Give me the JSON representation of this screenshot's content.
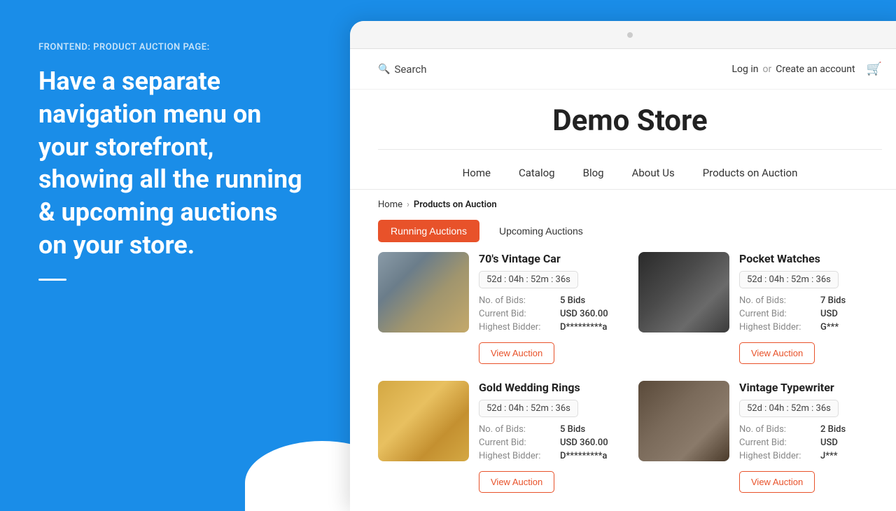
{
  "left": {
    "label": "FRONTEND: PRODUCT AUCTION PAGE:",
    "heading": "Have a separate navigation menu on your storefront, showing all the running & upcoming auctions on your store."
  },
  "browser": {
    "dot": ""
  },
  "header": {
    "search_label": "Search",
    "login_label": "Log in",
    "or_label": "or",
    "create_account_label": "Create an account"
  },
  "store": {
    "title": "Demo Store"
  },
  "nav": {
    "items": [
      {
        "label": "Home",
        "id": "home"
      },
      {
        "label": "Catalog",
        "id": "catalog"
      },
      {
        "label": "Blog",
        "id": "blog"
      },
      {
        "label": "About Us",
        "id": "about"
      },
      {
        "label": "Products on Auction",
        "id": "auction"
      }
    ]
  },
  "breadcrumb": {
    "home": "Home",
    "separator": "›",
    "current": "Products on Auction"
  },
  "tabs": {
    "running": "Running Auctions",
    "upcoming": "Upcoming Auctions"
  },
  "auctions": [
    {
      "title": "70's Vintage Car",
      "timer": "52d : 04h : 52m : 36s",
      "bids_label": "No. of Bids:",
      "bids_value": "5 Bids",
      "bid_label": "Current Bid:",
      "bid_value": "USD 360.00",
      "bidder_label": "Highest Bidder:",
      "bidder_value": "D*********a",
      "btn": "View Auction",
      "img_class": "img-car"
    },
    {
      "title": "Pocket Watches",
      "timer": "52d : 04h : 52m : 36s",
      "bids_label": "No. of Bids:",
      "bids_value": "7 Bids",
      "bid_label": "Current Bid:",
      "bid_value": "USD",
      "bidder_label": "Highest Bidder:",
      "bidder_value": "G***",
      "btn": "View Auction",
      "img_class": "img-watches"
    },
    {
      "title": "Gold Wedding Rings",
      "timer": "52d : 04h : 52m : 36s",
      "bids_label": "No. of Bids:",
      "bids_value": "5 Bids",
      "bid_label": "Current Bid:",
      "bid_value": "USD 360.00",
      "bidder_label": "Highest Bidder:",
      "bidder_value": "D*********a",
      "btn": "View Auction",
      "img_class": "img-rings"
    },
    {
      "title": "Vintage Typewriter",
      "timer": "52d : 04h : 52m : 36s",
      "bids_label": "No. of Bids:",
      "bids_value": "2 Bids",
      "bid_label": "Current Bid:",
      "bid_value": "USD",
      "bidder_label": "Highest Bidder:",
      "bidder_value": "J***",
      "btn": "View Auction",
      "img_class": "img-typewriter"
    }
  ]
}
